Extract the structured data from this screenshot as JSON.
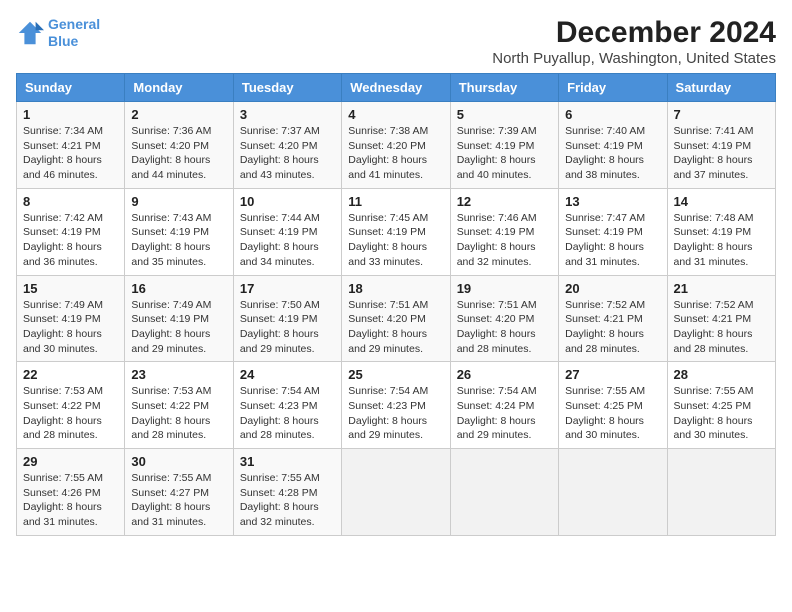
{
  "header": {
    "logo_line1": "General",
    "logo_line2": "Blue",
    "main_title": "December 2024",
    "subtitle": "North Puyallup, Washington, United States"
  },
  "calendar": {
    "days_of_week": [
      "Sunday",
      "Monday",
      "Tuesday",
      "Wednesday",
      "Thursday",
      "Friday",
      "Saturday"
    ],
    "weeks": [
      [
        {
          "day": 1,
          "sunrise": "7:34 AM",
          "sunset": "4:21 PM",
          "daylight": "8 hours and 46 minutes."
        },
        {
          "day": 2,
          "sunrise": "7:36 AM",
          "sunset": "4:20 PM",
          "daylight": "8 hours and 44 minutes."
        },
        {
          "day": 3,
          "sunrise": "7:37 AM",
          "sunset": "4:20 PM",
          "daylight": "8 hours and 43 minutes."
        },
        {
          "day": 4,
          "sunrise": "7:38 AM",
          "sunset": "4:20 PM",
          "daylight": "8 hours and 41 minutes."
        },
        {
          "day": 5,
          "sunrise": "7:39 AM",
          "sunset": "4:19 PM",
          "daylight": "8 hours and 40 minutes."
        },
        {
          "day": 6,
          "sunrise": "7:40 AM",
          "sunset": "4:19 PM",
          "daylight": "8 hours and 38 minutes."
        },
        {
          "day": 7,
          "sunrise": "7:41 AM",
          "sunset": "4:19 PM",
          "daylight": "8 hours and 37 minutes."
        }
      ],
      [
        {
          "day": 8,
          "sunrise": "7:42 AM",
          "sunset": "4:19 PM",
          "daylight": "8 hours and 36 minutes."
        },
        {
          "day": 9,
          "sunrise": "7:43 AM",
          "sunset": "4:19 PM",
          "daylight": "8 hours and 35 minutes."
        },
        {
          "day": 10,
          "sunrise": "7:44 AM",
          "sunset": "4:19 PM",
          "daylight": "8 hours and 34 minutes."
        },
        {
          "day": 11,
          "sunrise": "7:45 AM",
          "sunset": "4:19 PM",
          "daylight": "8 hours and 33 minutes."
        },
        {
          "day": 12,
          "sunrise": "7:46 AM",
          "sunset": "4:19 PM",
          "daylight": "8 hours and 32 minutes."
        },
        {
          "day": 13,
          "sunrise": "7:47 AM",
          "sunset": "4:19 PM",
          "daylight": "8 hours and 31 minutes."
        },
        {
          "day": 14,
          "sunrise": "7:48 AM",
          "sunset": "4:19 PM",
          "daylight": "8 hours and 31 minutes."
        }
      ],
      [
        {
          "day": 15,
          "sunrise": "7:49 AM",
          "sunset": "4:19 PM",
          "daylight": "8 hours and 30 minutes."
        },
        {
          "day": 16,
          "sunrise": "7:49 AM",
          "sunset": "4:19 PM",
          "daylight": "8 hours and 29 minutes."
        },
        {
          "day": 17,
          "sunrise": "7:50 AM",
          "sunset": "4:19 PM",
          "daylight": "8 hours and 29 minutes."
        },
        {
          "day": 18,
          "sunrise": "7:51 AM",
          "sunset": "4:20 PM",
          "daylight": "8 hours and 29 minutes."
        },
        {
          "day": 19,
          "sunrise": "7:51 AM",
          "sunset": "4:20 PM",
          "daylight": "8 hours and 28 minutes."
        },
        {
          "day": 20,
          "sunrise": "7:52 AM",
          "sunset": "4:21 PM",
          "daylight": "8 hours and 28 minutes."
        },
        {
          "day": 21,
          "sunrise": "7:52 AM",
          "sunset": "4:21 PM",
          "daylight": "8 hours and 28 minutes."
        }
      ],
      [
        {
          "day": 22,
          "sunrise": "7:53 AM",
          "sunset": "4:22 PM",
          "daylight": "8 hours and 28 minutes."
        },
        {
          "day": 23,
          "sunrise": "7:53 AM",
          "sunset": "4:22 PM",
          "daylight": "8 hours and 28 minutes."
        },
        {
          "day": 24,
          "sunrise": "7:54 AM",
          "sunset": "4:23 PM",
          "daylight": "8 hours and 28 minutes."
        },
        {
          "day": 25,
          "sunrise": "7:54 AM",
          "sunset": "4:23 PM",
          "daylight": "8 hours and 29 minutes."
        },
        {
          "day": 26,
          "sunrise": "7:54 AM",
          "sunset": "4:24 PM",
          "daylight": "8 hours and 29 minutes."
        },
        {
          "day": 27,
          "sunrise": "7:55 AM",
          "sunset": "4:25 PM",
          "daylight": "8 hours and 30 minutes."
        },
        {
          "day": 28,
          "sunrise": "7:55 AM",
          "sunset": "4:25 PM",
          "daylight": "8 hours and 30 minutes."
        }
      ],
      [
        {
          "day": 29,
          "sunrise": "7:55 AM",
          "sunset": "4:26 PM",
          "daylight": "8 hours and 31 minutes."
        },
        {
          "day": 30,
          "sunrise": "7:55 AM",
          "sunset": "4:27 PM",
          "daylight": "8 hours and 31 minutes."
        },
        {
          "day": 31,
          "sunrise": "7:55 AM",
          "sunset": "4:28 PM",
          "daylight": "8 hours and 32 minutes."
        },
        null,
        null,
        null,
        null
      ]
    ]
  }
}
